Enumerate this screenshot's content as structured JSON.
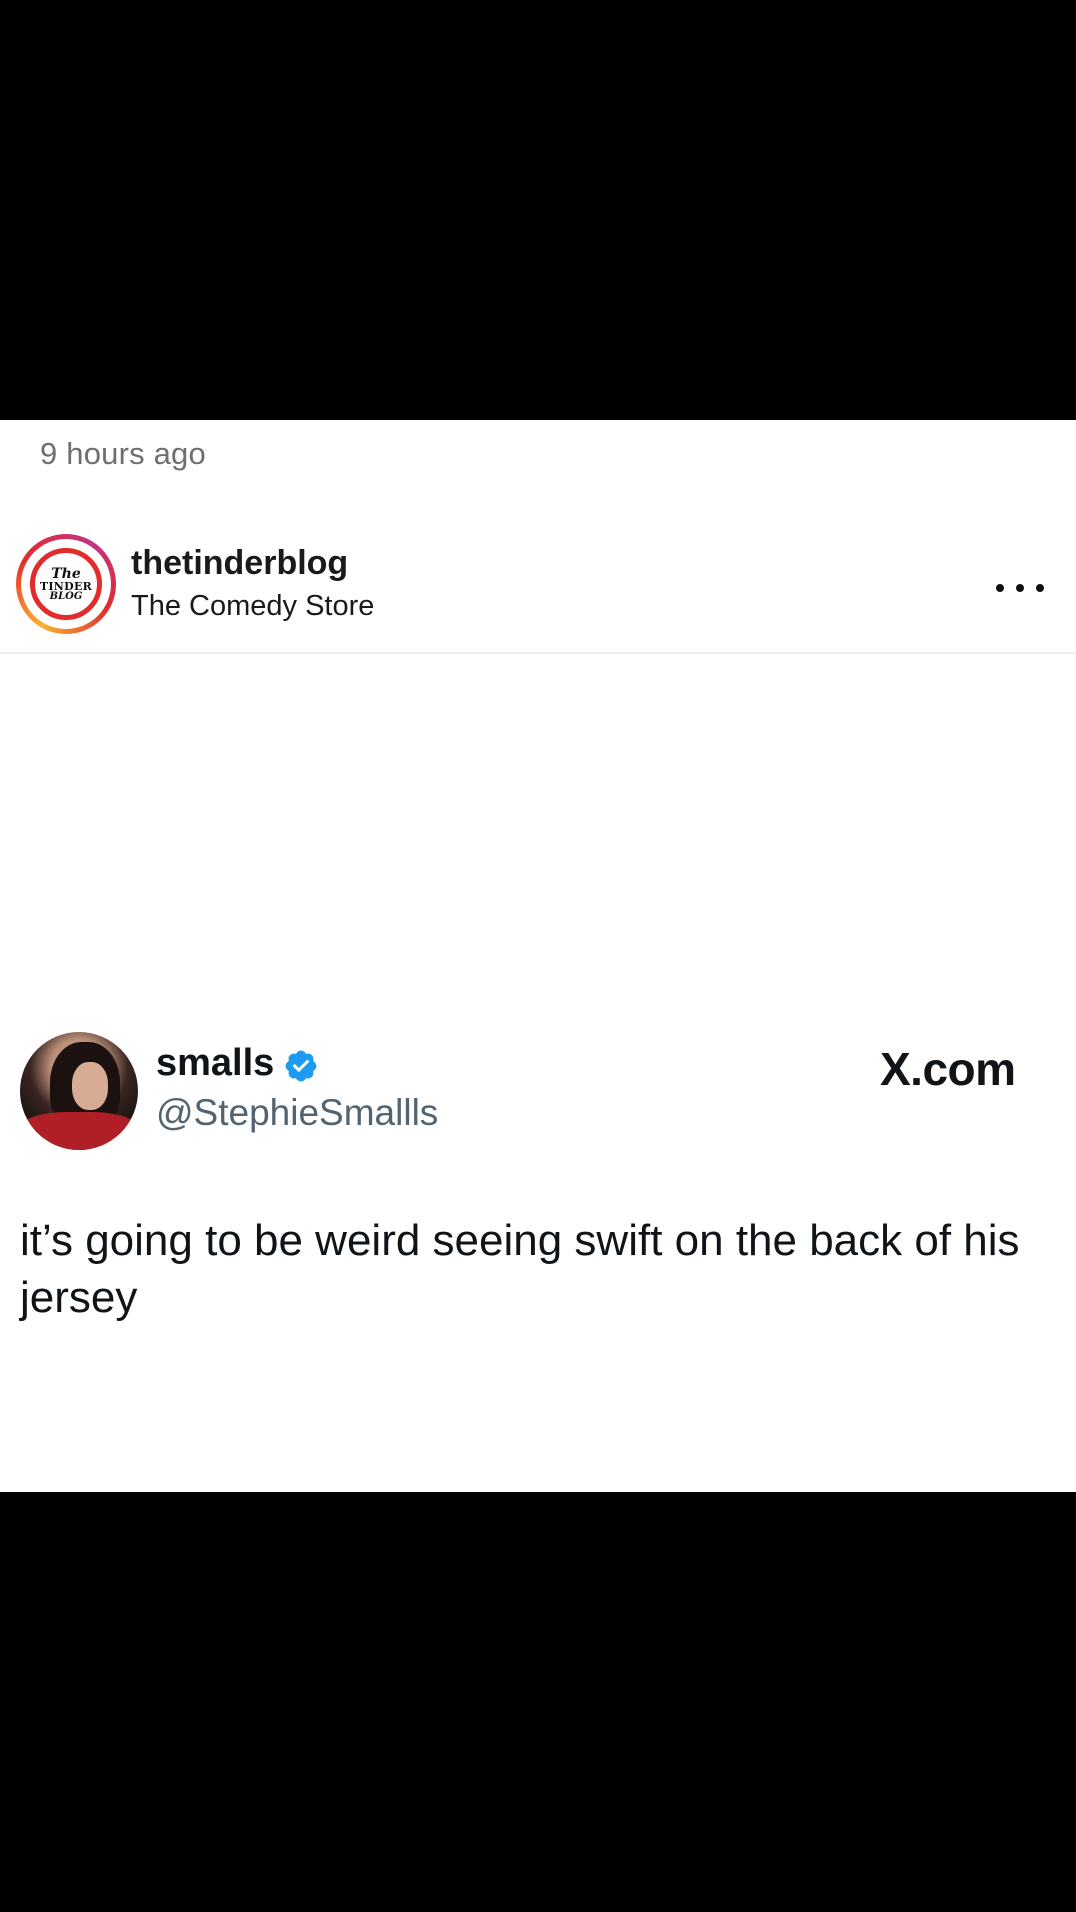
{
  "post": {
    "timestamp": "9 hours ago",
    "account_name": "thetinderblog",
    "location": "The Comedy Store",
    "avatar_logo": {
      "line1": "The",
      "line2": "TINDER",
      "line3": "BLOG"
    },
    "more_icon": "more-horizontal-icon"
  },
  "tweet": {
    "display_name": "smalls",
    "verified_icon": "verified-badge-icon",
    "handle": "@StephieSmallls",
    "source": "X.com",
    "text": "it’s going to be weird seeing swift on the back of his jersey"
  },
  "colors": {
    "background": "#000000",
    "card": "#ffffff",
    "verified": "#1d9bf0",
    "logo_ring": "#e32b2b"
  }
}
